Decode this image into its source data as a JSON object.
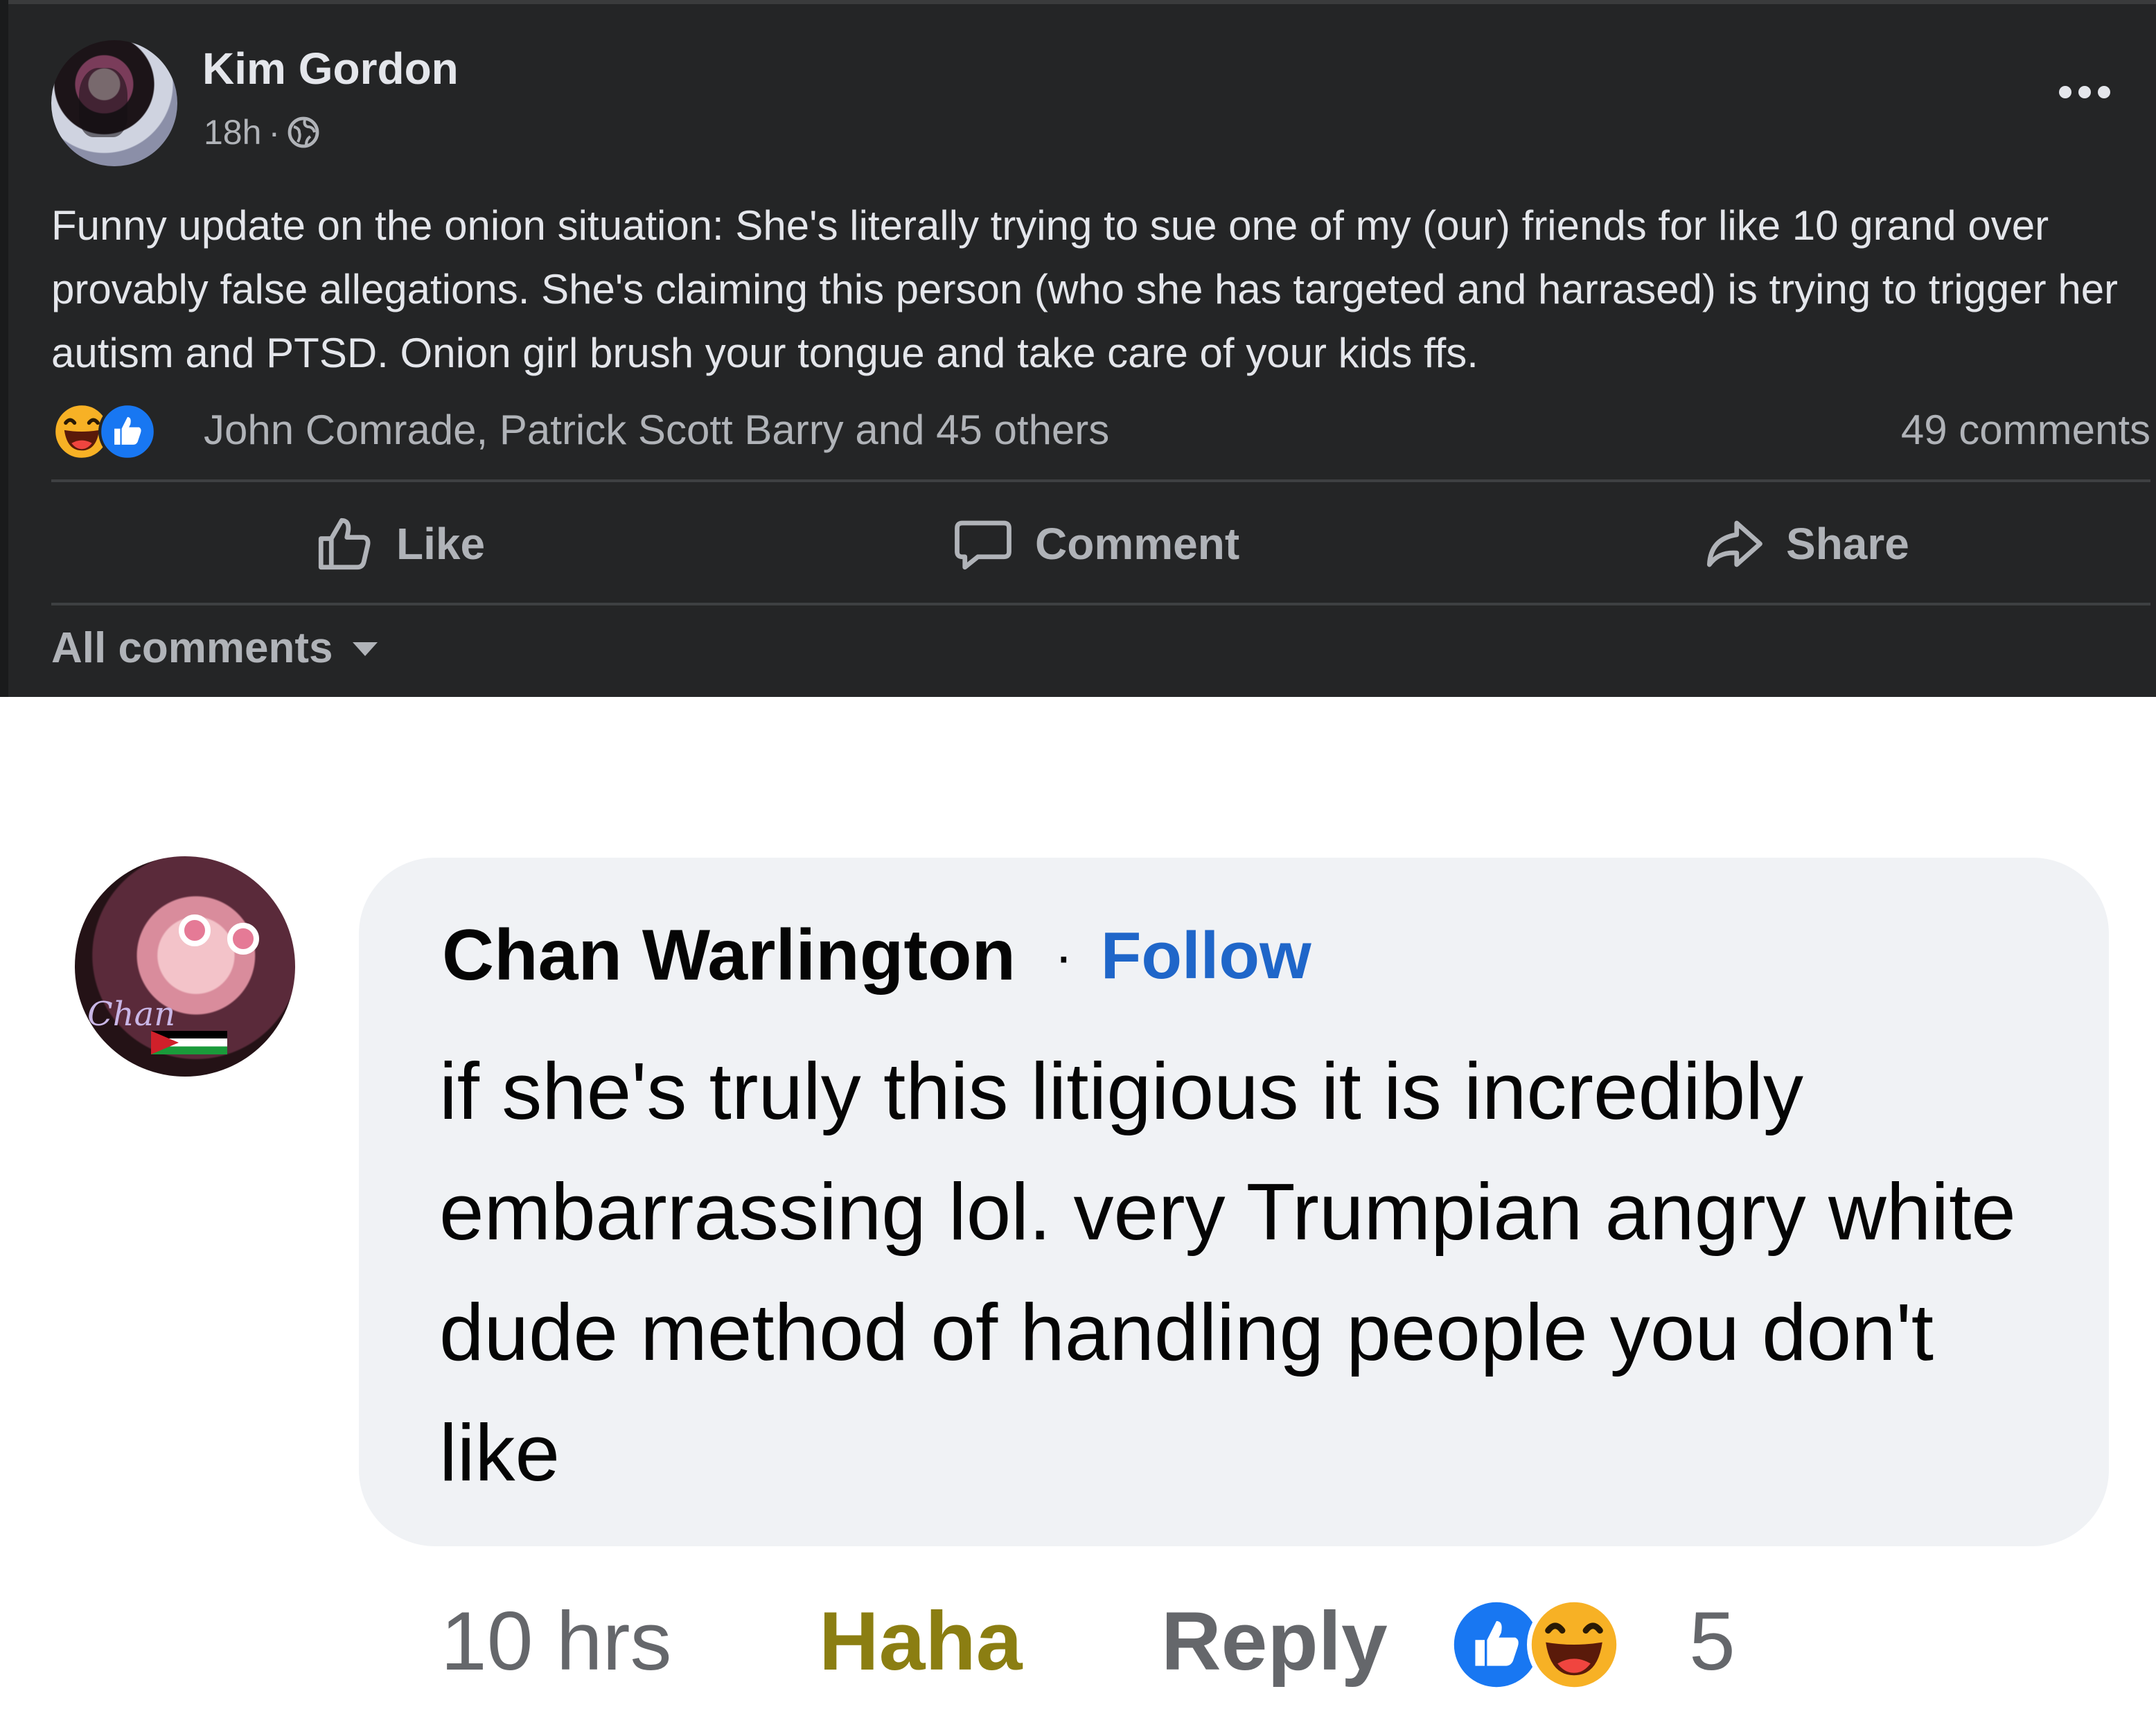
{
  "post": {
    "author": "Kim Gordon",
    "time": "18h",
    "meta_sep": "·",
    "text": "Funny update on the onion situation: She's literally trying to sue one of my (our) friends for like 10 grand over provably false allegations.  She's claiming this person (who she has targeted and harrased) is trying to trigger her autism and PTSD. Onion girl brush your tongue and take care of your kids ffs.",
    "reactions_names": "John Comrade, Patrick Scott Barry and 45 others",
    "comments_count": "49 comments",
    "actions": {
      "like": "Like",
      "comment": "Comment",
      "share": "Share"
    },
    "all_comments": "All comments",
    "icons": [
      "globe-icon",
      "more-icon",
      "haha-reaction-icon",
      "like-reaction-icon",
      "thumbs-up-icon",
      "comment-bubble-icon",
      "share-arrow-icon",
      "caret-down-icon"
    ]
  },
  "comment": {
    "author": "Chan Warlington",
    "separator": "·",
    "follow": "Follow",
    "text": "if she's truly this litigious it is incredibly embarrassing lol. very Trumpian angry white dude method of handling people you don't like",
    "time": "10 hrs",
    "reaction_label": "Haha",
    "reply": "Reply",
    "reaction_count": "5",
    "avatar_signature": "Chan"
  },
  "colors": {
    "dark_bg": "#242526",
    "dark_text": "#e4e6eb",
    "dark_secondary": "#b0b3b8",
    "bubble_bg": "#f0f2f5",
    "follow_blue": "#1f66c9",
    "haha_gold": "#8b7e12",
    "secondary_gray": "#65676b",
    "like_blue": "#1877f2",
    "haha_yellow": "#f7b125"
  }
}
